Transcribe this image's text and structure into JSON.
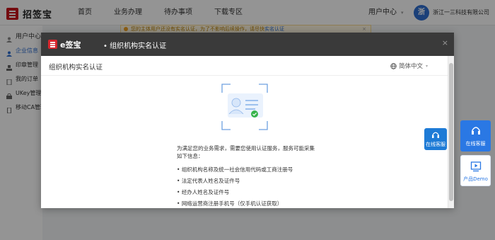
{
  "header": {
    "logo_text": "招签宝",
    "nav": [
      "首页",
      "业务办理",
      "待办事项",
      "下载专区"
    ],
    "user_center": "用户中心",
    "company": "浙江一三科技有限公司",
    "avatar_text": "浙",
    "notice": {
      "text": "您的主体用户还没有实名认证，为了不影响后续操作，请尽快",
      "link": "实名认证"
    }
  },
  "sidebar": {
    "title": "用户中心",
    "items": [
      "企业信息",
      "印章管理",
      "我的订单",
      "UKey管理",
      "移动CA管理"
    ]
  },
  "modal": {
    "brand": "e签宝",
    "title": "组织机构实名认证",
    "subtitle": "组织机构实名认证",
    "language": "简体中文",
    "intro": "为满足您的业务需求，需要您使用认证服务，服务可能采集如下信息：",
    "bullets": [
      "组织机构名称及统一社会信用代码或工商注册号",
      "法定代表人姓名及证件号",
      "经办人姓名及证件号",
      "网络运营商注册手机号（仅手机认证获取）"
    ]
  },
  "floating": {
    "service_small": "在线客服",
    "service": "在线客服",
    "demo": "产品Demo"
  },
  "colors": {
    "brand_red": "#c8161d",
    "link_blue": "#2f6fd1",
    "accent_green": "#36b34a"
  }
}
